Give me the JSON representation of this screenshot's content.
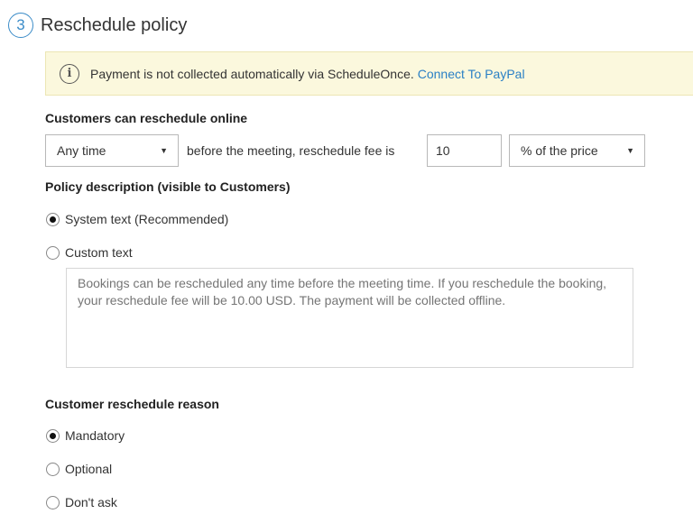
{
  "section": {
    "step_number": "3",
    "title": "Reschedule policy"
  },
  "banner": {
    "message": "Payment is not collected automatically via ScheduleOnce.",
    "link_label": "Connect To PayPal",
    "info_icon_glyph": "i"
  },
  "reschedule": {
    "label": "Customers can reschedule online",
    "time_select_value": "Any time",
    "middle_text": "before the meeting, reschedule fee is",
    "fee_value": "10",
    "fee_unit_select_value": "% of the price"
  },
  "policy": {
    "label": "Policy description (visible to Customers)",
    "options": [
      {
        "label": "System text (Recommended)",
        "checked": true
      },
      {
        "label": "Custom text",
        "checked": false
      }
    ],
    "custom_text_placeholder": "Bookings can be rescheduled any time before the meeting time. If you reschedule the booking, your reschedule fee will be 10.00 USD. The payment will be collected offline."
  },
  "reason": {
    "label": "Customer reschedule reason",
    "options": [
      {
        "label": "Mandatory",
        "checked": true
      },
      {
        "label": "Optional",
        "checked": false
      },
      {
        "label": "Don't ask",
        "checked": false
      }
    ]
  },
  "colors": {
    "accent": "#3b8cc8",
    "link": "#2a80c5",
    "banner_bg": "#fbf8dd"
  },
  "icons": {
    "select_caret": "caret-down-icon",
    "info": "info-icon"
  }
}
